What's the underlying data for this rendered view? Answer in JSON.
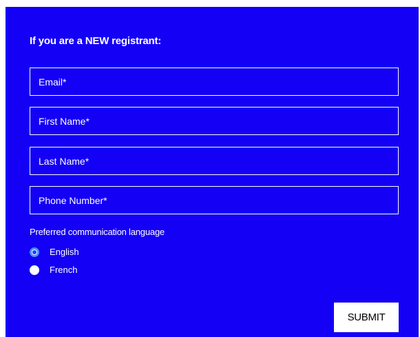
{
  "form": {
    "heading": "If you are a NEW registrant:",
    "fields": [
      {
        "placeholder": "Email*",
        "value": ""
      },
      {
        "placeholder": "First Name*",
        "value": ""
      },
      {
        "placeholder": "Last Name*",
        "value": ""
      },
      {
        "placeholder": "Phone Number*",
        "value": ""
      }
    ],
    "language": {
      "label": "Preferred communication language",
      "options": [
        {
          "label": "English",
          "selected": true
        },
        {
          "label": "French",
          "selected": false
        }
      ]
    },
    "submit_label": "SUBMIT"
  },
  "colors": {
    "panel_background": "#1400f5",
    "text": "#ffffff",
    "radio_focus": "#4d90fe",
    "button_background": "#ffffff",
    "button_text": "#000000"
  }
}
